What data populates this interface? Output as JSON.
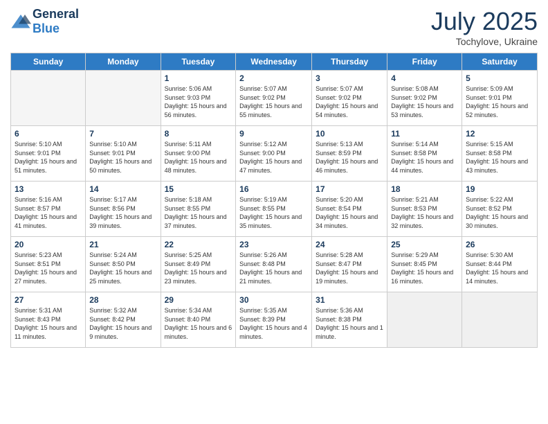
{
  "header": {
    "logo": {
      "general": "General",
      "blue": "Blue"
    },
    "title": "July 2025",
    "location": "Tochylove, Ukraine"
  },
  "days_of_week": [
    "Sunday",
    "Monday",
    "Tuesday",
    "Wednesday",
    "Thursday",
    "Friday",
    "Saturday"
  ],
  "weeks": [
    [
      {
        "day": "",
        "empty": true
      },
      {
        "day": "",
        "empty": true
      },
      {
        "day": "1",
        "sunrise": "5:06 AM",
        "sunset": "9:03 PM",
        "daylight": "15 hours and 56 minutes."
      },
      {
        "day": "2",
        "sunrise": "5:07 AM",
        "sunset": "9:02 PM",
        "daylight": "15 hours and 55 minutes."
      },
      {
        "day": "3",
        "sunrise": "5:07 AM",
        "sunset": "9:02 PM",
        "daylight": "15 hours and 54 minutes."
      },
      {
        "day": "4",
        "sunrise": "5:08 AM",
        "sunset": "9:02 PM",
        "daylight": "15 hours and 53 minutes."
      },
      {
        "day": "5",
        "sunrise": "5:09 AM",
        "sunset": "9:01 PM",
        "daylight": "15 hours and 52 minutes."
      }
    ],
    [
      {
        "day": "6",
        "sunrise": "5:10 AM",
        "sunset": "9:01 PM",
        "daylight": "15 hours and 51 minutes."
      },
      {
        "day": "7",
        "sunrise": "5:10 AM",
        "sunset": "9:01 PM",
        "daylight": "15 hours and 50 minutes."
      },
      {
        "day": "8",
        "sunrise": "5:11 AM",
        "sunset": "9:00 PM",
        "daylight": "15 hours and 48 minutes."
      },
      {
        "day": "9",
        "sunrise": "5:12 AM",
        "sunset": "9:00 PM",
        "daylight": "15 hours and 47 minutes."
      },
      {
        "day": "10",
        "sunrise": "5:13 AM",
        "sunset": "8:59 PM",
        "daylight": "15 hours and 46 minutes."
      },
      {
        "day": "11",
        "sunrise": "5:14 AM",
        "sunset": "8:58 PM",
        "daylight": "15 hours and 44 minutes."
      },
      {
        "day": "12",
        "sunrise": "5:15 AM",
        "sunset": "8:58 PM",
        "daylight": "15 hours and 43 minutes."
      }
    ],
    [
      {
        "day": "13",
        "sunrise": "5:16 AM",
        "sunset": "8:57 PM",
        "daylight": "15 hours and 41 minutes."
      },
      {
        "day": "14",
        "sunrise": "5:17 AM",
        "sunset": "8:56 PM",
        "daylight": "15 hours and 39 minutes."
      },
      {
        "day": "15",
        "sunrise": "5:18 AM",
        "sunset": "8:55 PM",
        "daylight": "15 hours and 37 minutes."
      },
      {
        "day": "16",
        "sunrise": "5:19 AM",
        "sunset": "8:55 PM",
        "daylight": "15 hours and 35 minutes."
      },
      {
        "day": "17",
        "sunrise": "5:20 AM",
        "sunset": "8:54 PM",
        "daylight": "15 hours and 34 minutes."
      },
      {
        "day": "18",
        "sunrise": "5:21 AM",
        "sunset": "8:53 PM",
        "daylight": "15 hours and 32 minutes."
      },
      {
        "day": "19",
        "sunrise": "5:22 AM",
        "sunset": "8:52 PM",
        "daylight": "15 hours and 30 minutes."
      }
    ],
    [
      {
        "day": "20",
        "sunrise": "5:23 AM",
        "sunset": "8:51 PM",
        "daylight": "15 hours and 27 minutes."
      },
      {
        "day": "21",
        "sunrise": "5:24 AM",
        "sunset": "8:50 PM",
        "daylight": "15 hours and 25 minutes."
      },
      {
        "day": "22",
        "sunrise": "5:25 AM",
        "sunset": "8:49 PM",
        "daylight": "15 hours and 23 minutes."
      },
      {
        "day": "23",
        "sunrise": "5:26 AM",
        "sunset": "8:48 PM",
        "daylight": "15 hours and 21 minutes."
      },
      {
        "day": "24",
        "sunrise": "5:28 AM",
        "sunset": "8:47 PM",
        "daylight": "15 hours and 19 minutes."
      },
      {
        "day": "25",
        "sunrise": "5:29 AM",
        "sunset": "8:45 PM",
        "daylight": "15 hours and 16 minutes."
      },
      {
        "day": "26",
        "sunrise": "5:30 AM",
        "sunset": "8:44 PM",
        "daylight": "15 hours and 14 minutes."
      }
    ],
    [
      {
        "day": "27",
        "sunrise": "5:31 AM",
        "sunset": "8:43 PM",
        "daylight": "15 hours and 11 minutes."
      },
      {
        "day": "28",
        "sunrise": "5:32 AM",
        "sunset": "8:42 PM",
        "daylight": "15 hours and 9 minutes."
      },
      {
        "day": "29",
        "sunrise": "5:34 AM",
        "sunset": "8:40 PM",
        "daylight": "15 hours and 6 minutes."
      },
      {
        "day": "30",
        "sunrise": "5:35 AM",
        "sunset": "8:39 PM",
        "daylight": "15 hours and 4 minutes."
      },
      {
        "day": "31",
        "sunrise": "5:36 AM",
        "sunset": "8:38 PM",
        "daylight": "15 hours and 1 minute."
      },
      {
        "day": "",
        "empty": true,
        "shaded": true
      },
      {
        "day": "",
        "empty": true,
        "shaded": true
      }
    ]
  ]
}
